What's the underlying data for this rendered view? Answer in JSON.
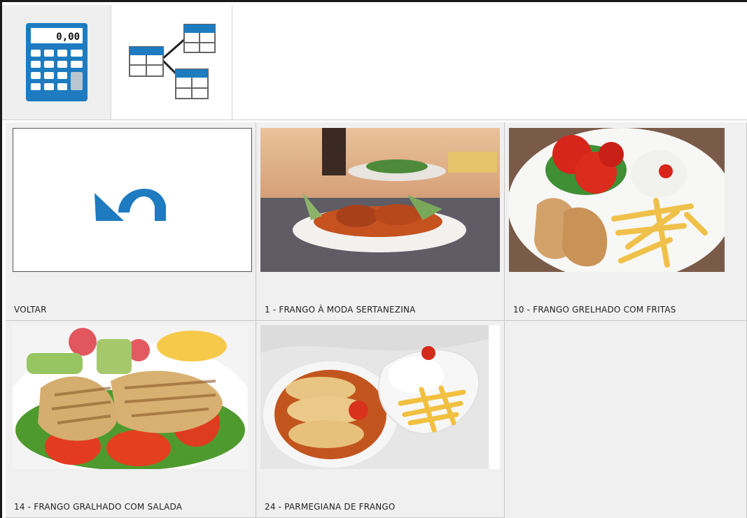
{
  "toolbar": {
    "buttons": [
      {
        "id": "calculator",
        "icon": "calculator-icon",
        "display": "0,00",
        "active": true
      },
      {
        "id": "tables",
        "icon": "table-tree-icon",
        "active": false
      }
    ]
  },
  "grid": {
    "items": [
      {
        "label": "VOLTAR",
        "icon": "undo-arrow-icon"
      },
      {
        "label": "1 - FRANGO À MODA SERTANEZINA"
      },
      {
        "label": "10 - FRANGO GRELHADO COM FRITAS"
      },
      {
        "label": "14 - FRANGO GRALHADO COM SALADA"
      },
      {
        "label": "24 - PARMEGIANA DE FRANGO"
      }
    ]
  },
  "colors": {
    "accent_blue": "#1e7bbf",
    "tile_bg": "#f0f0f0",
    "divider": "#c7c7c7"
  }
}
